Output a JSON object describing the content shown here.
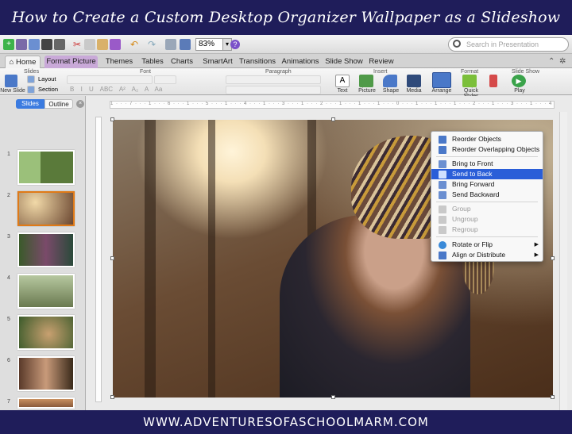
{
  "banner": {
    "title": "How to Create a Custom Desktop Organizer Wallpaper as a Slideshow",
    "footer": "WWW.ADVENTURESOFASCHOOLMARM.COM"
  },
  "toolbar": {
    "zoom": "83%",
    "help": "?",
    "search_placeholder": "Search in Presentation"
  },
  "tabs": [
    "Home",
    "Format Picture",
    "Themes",
    "Tables",
    "Charts",
    "SmartArt",
    "Transitions",
    "Animations",
    "Slide Show",
    "Review"
  ],
  "ribbon": {
    "groups": {
      "slides": "Slides",
      "font": "Font",
      "paragraph": "Paragraph",
      "insert": "Insert",
      "format": "Format",
      "slide_show": "Slide Show"
    },
    "new_slide": "New Slide",
    "layout": "Layout",
    "section": "Section",
    "insert_buttons": [
      "Text",
      "Picture",
      "Shape",
      "Media"
    ],
    "format_buttons": [
      "Arrange",
      "Quick Styles"
    ],
    "play": "Play",
    "font_buttons": [
      "B",
      "I",
      "U",
      "ABC",
      "A²",
      "A₂",
      "A",
      "Aa"
    ]
  },
  "panel": {
    "slides_tab": "Slides",
    "outline_tab": "Outline",
    "slide_numbers": [
      "1",
      "2",
      "3",
      "4",
      "5",
      "6",
      "7"
    ],
    "selected_slide": "2"
  },
  "ruler_text": "1 · · · 7 · · · 1 · · · 6 · · · 1 · · · 5 · · · 1 · · · 4 · · · 1 · · · 3 · · · 1 · · · 2 · · · 1 · · · 1 · · · 1 · · · 0 · · · 1 · · · 1 · · · 1 · · · 2 · · · 1 · · · 3 · · · 1 · · · 4 · · · 1 · · · 5 · · · 1 · · · 6 · · · 1 · · · 7",
  "menu": {
    "items": [
      {
        "label": "Reorder Objects",
        "state": "normal"
      },
      {
        "label": "Reorder Overlapping Objects",
        "state": "normal"
      },
      {
        "label": "Bring to Front",
        "state": "normal"
      },
      {
        "label": "Send to Back",
        "state": "highlighted"
      },
      {
        "label": "Bring Forward",
        "state": "normal"
      },
      {
        "label": "Send Backward",
        "state": "normal"
      },
      {
        "label": "Group",
        "state": "disabled"
      },
      {
        "label": "Ungroup",
        "state": "disabled"
      },
      {
        "label": "Regroup",
        "state": "disabled"
      },
      {
        "label": "Rotate or Flip",
        "state": "submenu"
      },
      {
        "label": "Align or Distribute",
        "state": "submenu"
      }
    ]
  },
  "colors": {
    "banner": "#1f1d5a",
    "format_tab": "#c9a9d8",
    "highlight": "#2a5ed8",
    "selected_thumb": "#e07a17"
  }
}
